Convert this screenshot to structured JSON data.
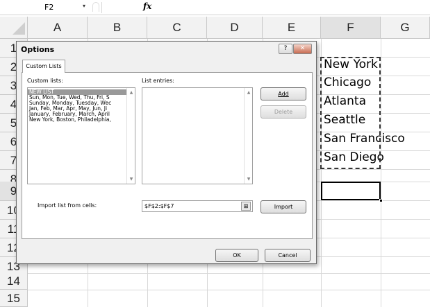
{
  "formula_bar": {
    "name_box": "F2",
    "name_box_arrow": "▾",
    "fx": "fx",
    "formula": ""
  },
  "sheet": {
    "columns": [
      "A",
      "B",
      "C",
      "D",
      "E",
      "F",
      "G"
    ],
    "rows": [
      "1",
      "2",
      "3",
      "4",
      "5",
      "6",
      "7",
      "8",
      "9",
      "10",
      "11",
      "12",
      "13",
      "14",
      "15"
    ],
    "active_column": "F",
    "active_row": "9",
    "cells_F": [
      "New York",
      "Chicago",
      "Atlanta",
      "Seattle",
      "San Francisco",
      "San Diego"
    ]
  },
  "dialog": {
    "title": "Options",
    "help": "?",
    "close": "✕",
    "tab": "Custom Lists",
    "custom_lists_label": "Custom lists:",
    "list_entries_label": "List entries:",
    "lists": [
      "NEW LIST",
      "Sun, Mon, Tue, Wed, Thu, Fri, S",
      "Sunday, Monday, Tuesday, Wec",
      "Jan, Feb, Mar, Apr, May, Jun, Ji",
      "January, February, March, April",
      "New York, Boston, Philadelphia,"
    ],
    "add_button": "Add",
    "delete_button": "Delete",
    "import_label": "Import list from cells:",
    "import_value": "$F$2:$F$7",
    "import_button": "Import",
    "ok_button": "OK",
    "cancel_button": "Cancel"
  }
}
